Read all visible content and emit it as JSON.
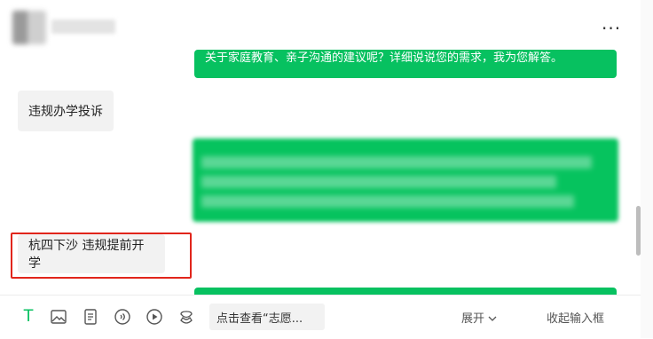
{
  "header": {
    "more_label": "···"
  },
  "messages": {
    "partial_reply_text": "关于家庭教育、亲子沟通的建议呢？详细说说您的需求，我为您解答。",
    "user_message_1": "违规办学投诉",
    "user_message_2": "杭四下沙 违规提前开学"
  },
  "toolbar": {
    "text_icon": "T",
    "quick_question": "点击查看“志愿...",
    "expand_label": "展开",
    "collapse_label": "收起输入框"
  },
  "colors": {
    "accent_green": "#07c160",
    "highlight_red": "#e1251b"
  }
}
